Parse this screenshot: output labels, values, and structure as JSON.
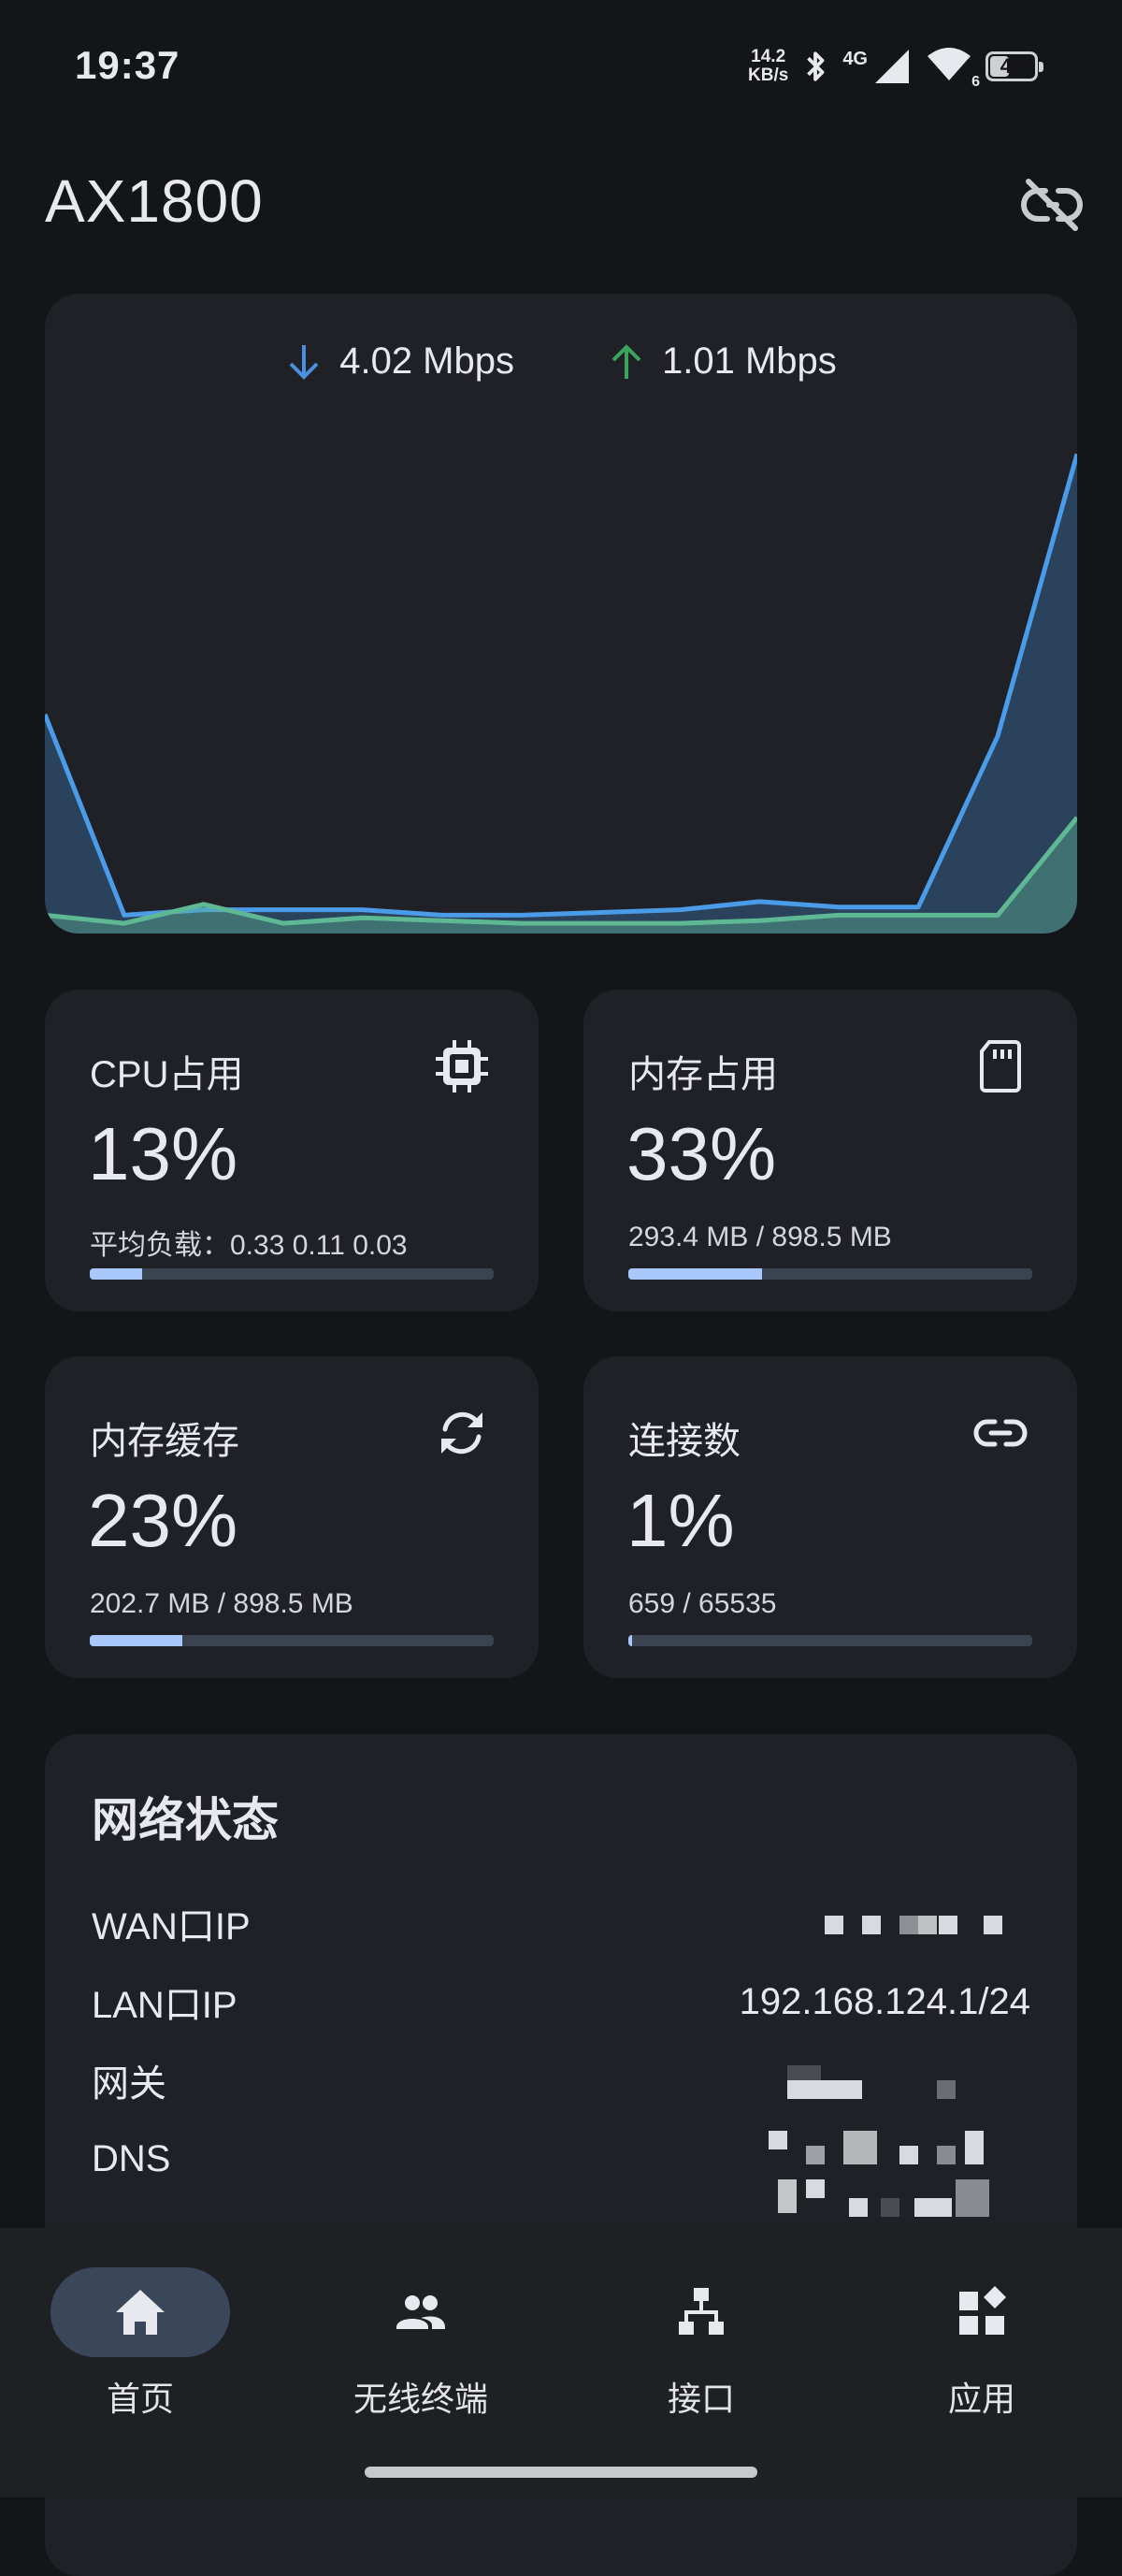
{
  "status_bar": {
    "time": "19:37",
    "net_speed_value": "14.2",
    "net_speed_unit": "KB/s",
    "bluetooth_icon": "bluetooth-icon",
    "network_type": "4G",
    "wifi_badge": "6",
    "battery": "45"
  },
  "header": {
    "title": "AX1800",
    "unlink_icon": "link-off-icon"
  },
  "traffic": {
    "download": "4.02 Mbps",
    "upload": "1.01 Mbps",
    "download_color": "#4a8fe0",
    "upload_color": "#3aa35d"
  },
  "chart_data": {
    "type": "area",
    "series": [
      {
        "color": "#4a9be8",
        "values": [
          0.39,
          0.02,
          0.03,
          0.03,
          0.03,
          0.02,
          0.02,
          0.025,
          0.03,
          0.045,
          0.035,
          0.035,
          0.35,
          0.87
        ]
      },
      {
        "color": "#5fb894",
        "values": [
          0.02,
          0.005,
          0.04,
          0.005,
          0.015,
          0.01,
          0.005,
          0.005,
          0.005,
          0.01,
          0.02,
          0.02,
          0.02,
          0.2
        ]
      }
    ]
  },
  "stats": [
    {
      "label": "CPU占用",
      "icon": "cpu-chip-icon",
      "value": "13%",
      "detail": "平均负载：0.33 0.11 0.03",
      "percent": 13
    },
    {
      "label": "内存占用",
      "icon": "memory-card-icon",
      "value": "33%",
      "detail": "293.4 MB / 898.5 MB",
      "percent": 33
    },
    {
      "label": "内存缓存",
      "icon": "sync-icon",
      "value": "23%",
      "detail": "202.7 MB / 898.5 MB",
      "percent": 23
    },
    {
      "label": "连接数",
      "icon": "link-icon",
      "value": "1%",
      "detail": "659 / 65535",
      "percent": 1
    }
  ],
  "network": {
    "title": "网络状态",
    "rows": [
      {
        "label": "WAN口IP"
      },
      {
        "label": "LAN口IP",
        "value": "192.168.124.1/24"
      },
      {
        "label": "网关"
      },
      {
        "label": "DNS"
      }
    ]
  },
  "nav": [
    {
      "label": "首页",
      "icon": "home-icon",
      "active": true
    },
    {
      "label": "无线终端",
      "icon": "people-icon",
      "active": false
    },
    {
      "label": "接口",
      "icon": "network-tree-icon",
      "active": false
    },
    {
      "label": "应用",
      "icon": "apps-icon",
      "active": false
    }
  ]
}
